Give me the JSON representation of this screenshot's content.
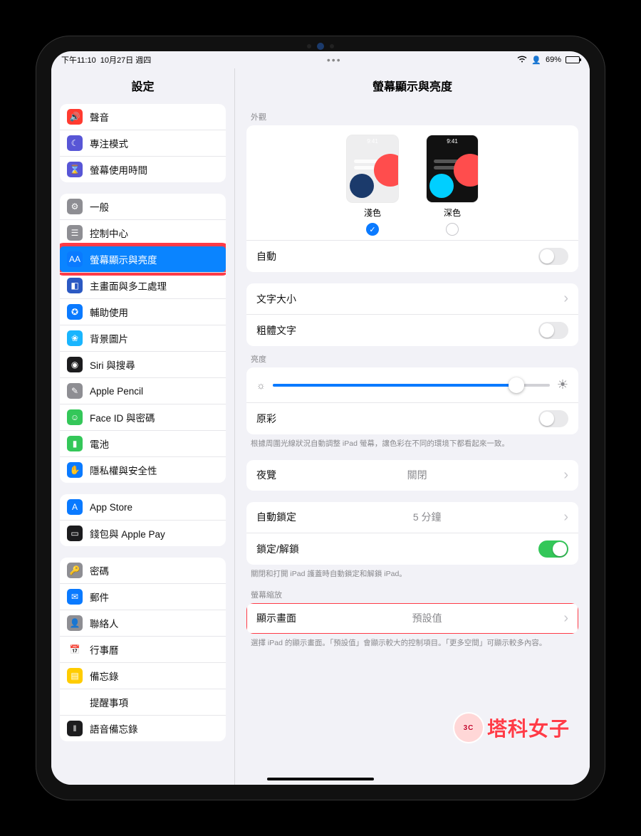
{
  "status": {
    "time": "下午11:10",
    "date": "10月27日 週四",
    "battery_pct": "69%"
  },
  "sidebar": {
    "title": "設定",
    "groups": [
      {
        "items": [
          {
            "id": "sounds",
            "label": "聲音",
            "icon_bg": "#ff3b30",
            "glyph": "🔊"
          },
          {
            "id": "focus",
            "label": "專注模式",
            "icon_bg": "#5856d6",
            "glyph": "☾"
          },
          {
            "id": "screentime",
            "label": "螢幕使用時間",
            "icon_bg": "#5856d6",
            "glyph": "⌛"
          }
        ]
      },
      {
        "items": [
          {
            "id": "general",
            "label": "一般",
            "icon_bg": "#8e8e93",
            "glyph": "⚙"
          },
          {
            "id": "controlcenter",
            "label": "控制中心",
            "icon_bg": "#8e8e93",
            "glyph": "☰"
          },
          {
            "id": "display",
            "label": "螢幕顯示與亮度",
            "icon_bg": "#0a7aff",
            "glyph": "AA",
            "selected": true,
            "highlighted": true
          },
          {
            "id": "homescreen",
            "label": "主畫面與多工處理",
            "icon_bg": "#2b59c3",
            "glyph": "◧"
          },
          {
            "id": "accessibility",
            "label": "輔助使用",
            "icon_bg": "#0a7aff",
            "glyph": "✪"
          },
          {
            "id": "wallpaper",
            "label": "背景圖片",
            "icon_bg": "#19b5fe",
            "glyph": "❀"
          },
          {
            "id": "siri",
            "label": "Siri 與搜尋",
            "icon_bg": "#1c1c1e",
            "glyph": "◉"
          },
          {
            "id": "pencil",
            "label": "Apple Pencil",
            "icon_bg": "#8e8e93",
            "glyph": "✎"
          },
          {
            "id": "faceid",
            "label": "Face ID 與密碼",
            "icon_bg": "#34c759",
            "glyph": "☺"
          },
          {
            "id": "battery",
            "label": "電池",
            "icon_bg": "#34c759",
            "glyph": "▮"
          },
          {
            "id": "privacy",
            "label": "隱私權與安全性",
            "icon_bg": "#0a7aff",
            "glyph": "✋"
          }
        ]
      },
      {
        "items": [
          {
            "id": "appstore",
            "label": "App Store",
            "icon_bg": "#0a7aff",
            "glyph": "A"
          },
          {
            "id": "wallet",
            "label": "錢包與 Apple Pay",
            "icon_bg": "#1c1c1e",
            "glyph": "▭"
          }
        ]
      },
      {
        "items": [
          {
            "id": "passwords",
            "label": "密碼",
            "icon_bg": "#8e8e93",
            "glyph": "🔑"
          },
          {
            "id": "mail",
            "label": "郵件",
            "icon_bg": "#0a7aff",
            "glyph": "✉"
          },
          {
            "id": "contacts",
            "label": "聯絡人",
            "icon_bg": "#8e8e93",
            "glyph": "👤"
          },
          {
            "id": "calendar",
            "label": "行事曆",
            "icon_bg": "#ffffff",
            "glyph": "📅"
          },
          {
            "id": "notes",
            "label": "備忘錄",
            "icon_bg": "#ffcc00",
            "glyph": "▤"
          },
          {
            "id": "reminders",
            "label": "提醒事項",
            "icon_bg": "#ffffff",
            "glyph": "☑"
          },
          {
            "id": "voicememos",
            "label": "語音備忘錄",
            "icon_bg": "#1c1c1e",
            "glyph": "‖"
          }
        ]
      }
    ]
  },
  "detail": {
    "title": "螢幕顯示與亮度",
    "appearance": {
      "header": "外觀",
      "clock": "9:41",
      "light_label": "淺色",
      "dark_label": "深色",
      "selected": "light",
      "auto_label": "自動",
      "auto_on": false
    },
    "text": {
      "size_label": "文字大小",
      "bold_label": "粗體文字",
      "bold_on": false
    },
    "brightness": {
      "header": "亮度",
      "value_pct": 88,
      "truetone_label": "原彩",
      "truetone_on": false,
      "truetone_footer": "根據周圍光線狀況自動調整 iPad 螢幕，讓色彩在不同的環境下都看起來一致。"
    },
    "nightshift": {
      "label": "夜覽",
      "value": "關閉"
    },
    "lock": {
      "auto_label": "自動鎖定",
      "auto_value": "5 分鐘",
      "cover_label": "鎖定/解鎖",
      "cover_on": true,
      "cover_footer": "關閉和打開 iPad 護蓋時自動鎖定和解鎖 iPad。"
    },
    "zoom": {
      "header": "螢幕縮放",
      "label": "顯示畫面",
      "value": "預設值",
      "footer": "選擇 iPad 的顯示畫面。「預設值」會顯示較大的控制項目。「更多空間」可顯示較多內容。",
      "highlighted": true
    }
  },
  "brand": {
    "avatar_text": "3C",
    "name": "塔科女子"
  }
}
